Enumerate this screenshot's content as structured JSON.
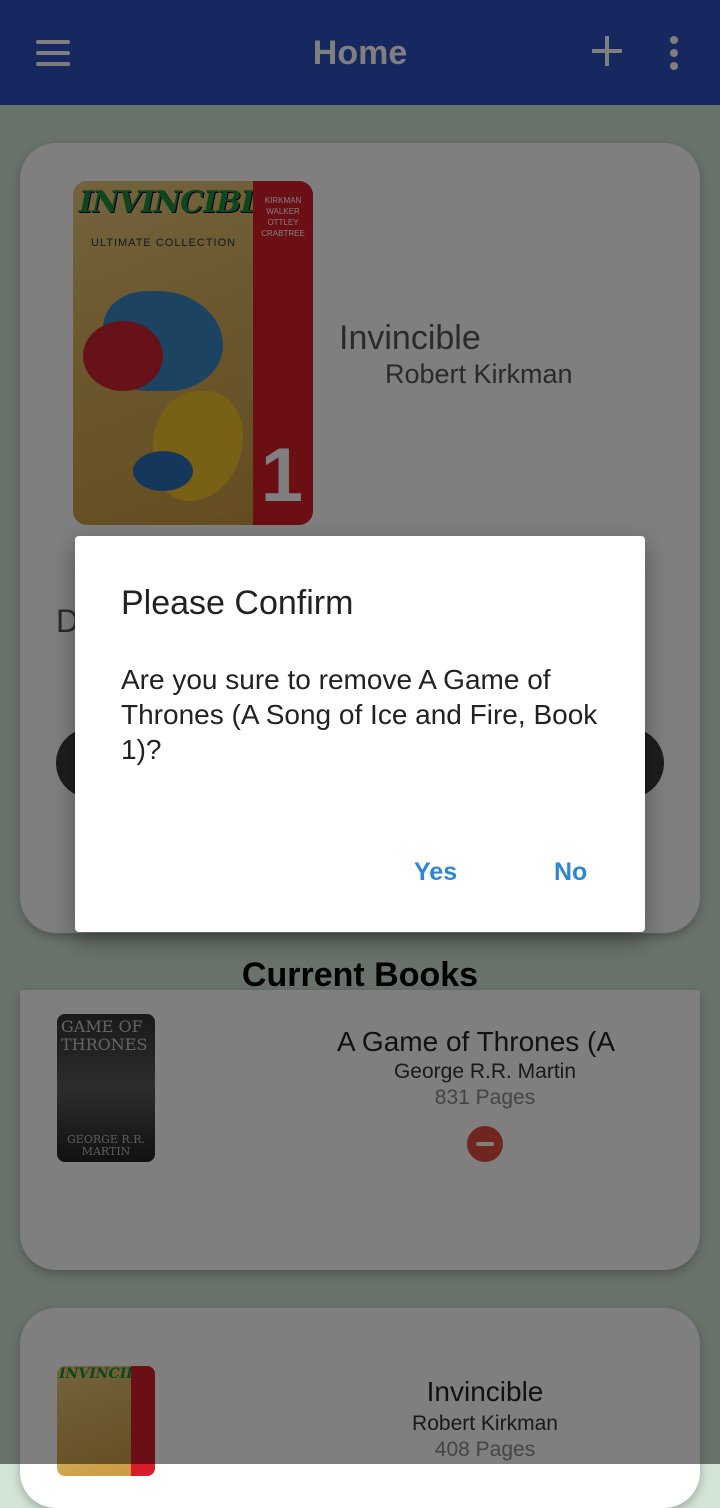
{
  "appbar": {
    "title": "Home",
    "icons": [
      "menu-icon",
      "plus-icon",
      "more-vert-icon"
    ],
    "color": "#2f4fbf"
  },
  "featured": {
    "title": "Invincible",
    "author": "Robert Kirkman",
    "partial_text": "D",
    "cover": {
      "logo": "INVINCIBLE",
      "subtitle": "ULTIMATE COLLECTION",
      "volume": "1",
      "creators": "KIRKMAN WALKER OTTLEY CRABTREE"
    }
  },
  "section": {
    "title": "Current Books"
  },
  "books": [
    {
      "title": "A Game of Thrones (A",
      "author": "George R.R. Martin",
      "pages": "831 Pages",
      "cover_title": "GAME OF THRONES",
      "cover_author": "GEORGE R.R. MARTIN"
    },
    {
      "title": "Invincible",
      "author": "Robert Kirkman",
      "pages": "408 Pages",
      "cover_title": "INVINCIBLE"
    }
  ],
  "dialog": {
    "title": "Please Confirm",
    "message": "Are you sure to remove A Game of Thrones (A Song of Ice and Fire, Book 1)?",
    "yes_label": "Yes",
    "no_label": "No",
    "accent": "#2e86d6"
  }
}
